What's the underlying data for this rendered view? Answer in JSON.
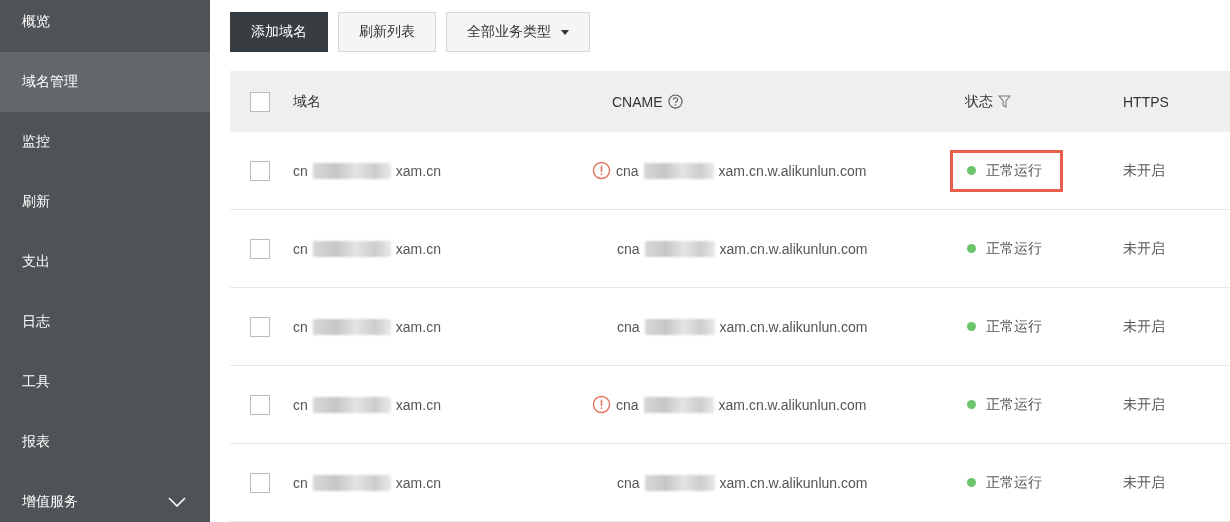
{
  "sidebar": {
    "items": [
      {
        "label": "概览",
        "selected": false
      },
      {
        "label": "域名管理",
        "selected": true
      },
      {
        "label": "监控",
        "selected": false
      },
      {
        "label": "刷新",
        "selected": false
      },
      {
        "label": "支出",
        "selected": false
      },
      {
        "label": "日志",
        "selected": false
      },
      {
        "label": "工具",
        "selected": false
      },
      {
        "label": "报表",
        "selected": false
      },
      {
        "label": "增值服务",
        "selected": false,
        "expandable": true
      }
    ]
  },
  "toolbar": {
    "buttons": [
      {
        "label": "添加域名",
        "kind": "primary"
      },
      {
        "label": "刷新列表",
        "kind": "plain"
      },
      {
        "label": "全部业务类型",
        "kind": "dropdown"
      }
    ]
  },
  "table": {
    "select_all_checked": false,
    "columns": [
      "域名",
      "CNAME",
      "状态",
      "HTTPS"
    ],
    "rows": [
      {
        "checked": false,
        "domain": {
          "prefix": "cn",
          "suffix": "xam.cn"
        },
        "cname": {
          "prefix": "cna",
          "suffix": "xam.cn.w.alikunlun.com",
          "warning": true
        },
        "status": {
          "label": "正常运行",
          "color": "#6cc56c",
          "highlighted": true
        },
        "https": "未开启"
      },
      {
        "checked": false,
        "domain": {
          "prefix": "cn",
          "suffix": "xam.cn"
        },
        "cname": {
          "prefix": "cna",
          "suffix": "xam.cn.w.alikunlun.com",
          "warning": false
        },
        "status": {
          "label": "正常运行",
          "color": "#6cc56c",
          "highlighted": false
        },
        "https": "未开启"
      },
      {
        "checked": false,
        "domain": {
          "prefix": "cn",
          "suffix": "xam.cn"
        },
        "cname": {
          "prefix": "cna",
          "suffix": "xam.cn.w.alikunlun.com",
          "warning": false
        },
        "status": {
          "label": "正常运行",
          "color": "#6cc56c",
          "highlighted": false
        },
        "https": "未开启"
      },
      {
        "checked": false,
        "domain": {
          "prefix": "cn",
          "suffix": "xam.cn"
        },
        "cname": {
          "prefix": "cna",
          "suffix": "xam.cn.w.alikunlun.com",
          "warning": true
        },
        "status": {
          "label": "正常运行",
          "color": "#6cc56c",
          "highlighted": false
        },
        "https": "未开启"
      },
      {
        "checked": false,
        "domain": {
          "prefix": "cn",
          "suffix": "xam.cn"
        },
        "cname": {
          "prefix": "cna",
          "suffix": "xam.cn.w.alikunlun.com",
          "warning": false
        },
        "status": {
          "label": "正常运行",
          "color": "#6cc56c",
          "highlighted": false
        },
        "https": "未开启"
      }
    ]
  }
}
